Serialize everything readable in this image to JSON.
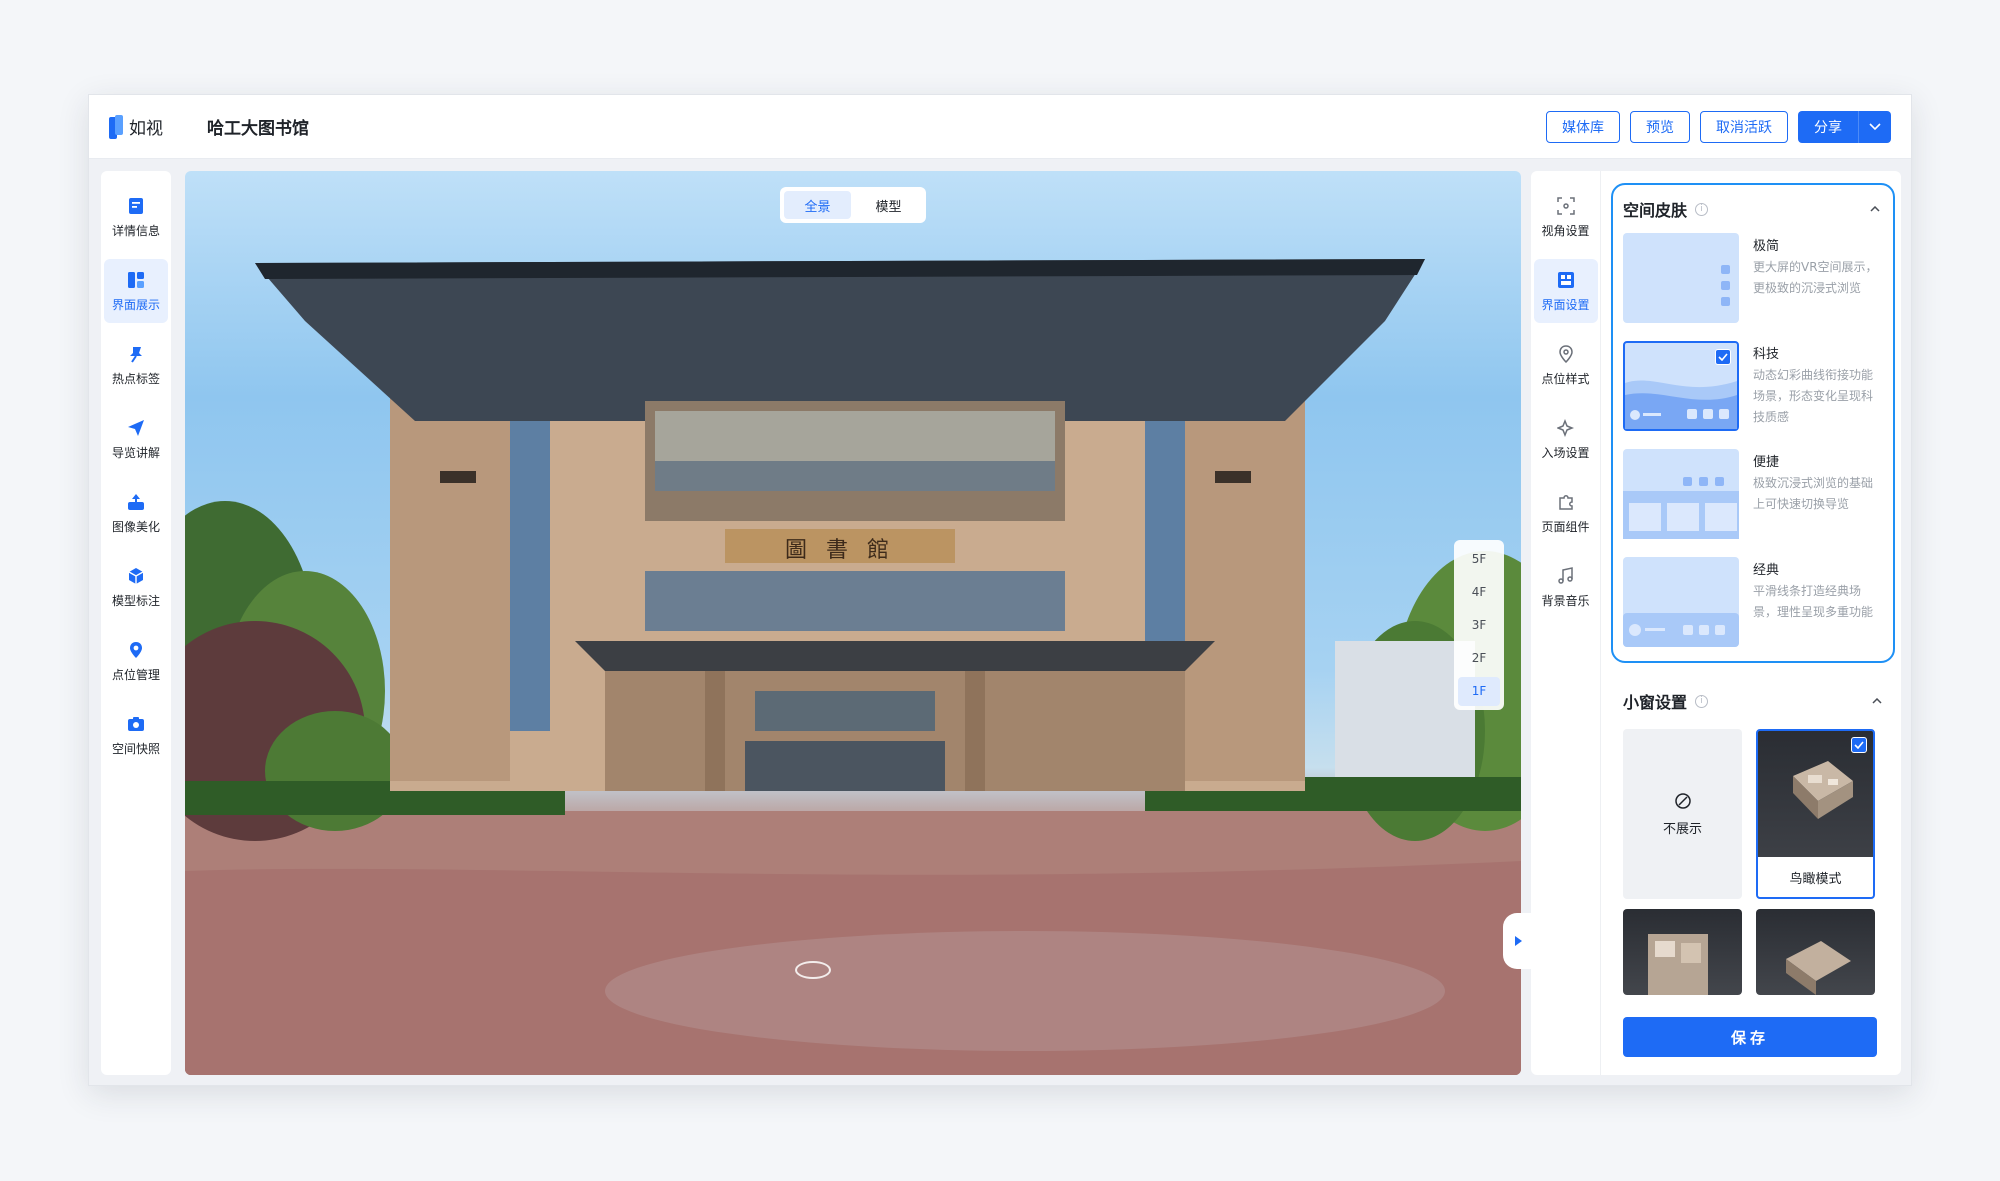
{
  "header": {
    "logo_text": "如视",
    "project_title": "哈工大图书馆",
    "actions": {
      "media_library": "媒体库",
      "preview": "预览",
      "cancel_activate": "取消活跃",
      "share": "分享"
    }
  },
  "left_nav": [
    {
      "label": "详情信息",
      "icon": "document-icon"
    },
    {
      "label": "界面展示",
      "icon": "layout-icon",
      "active": true
    },
    {
      "label": "热点标签",
      "icon": "pin-icon"
    },
    {
      "label": "导览讲解",
      "icon": "send-icon"
    },
    {
      "label": "图像美化",
      "icon": "upload-image-icon"
    },
    {
      "label": "模型标注",
      "icon": "cube-icon"
    },
    {
      "label": "点位管理",
      "icon": "location-icon"
    },
    {
      "label": "空间快照",
      "icon": "camera-icon"
    }
  ],
  "viewer": {
    "view_toggle": [
      "全景",
      "模型"
    ],
    "active_view": "全景",
    "building_sign": "圖 書 館",
    "floors": [
      "5F",
      "4F",
      "3F",
      "2F",
      "1F"
    ],
    "active_floor": "1F"
  },
  "right_nav": [
    {
      "label": "视角设置",
      "icon": "viewfinder-icon"
    },
    {
      "label": "界面设置",
      "icon": "interface-icon",
      "active": true
    },
    {
      "label": "点位样式",
      "icon": "location-outline-icon"
    },
    {
      "label": "入场设置",
      "icon": "sparkle-icon"
    },
    {
      "label": "页面组件",
      "icon": "puzzle-icon"
    },
    {
      "label": "背景音乐",
      "icon": "music-icon"
    }
  ],
  "panel": {
    "skin_section": {
      "title": "空间皮肤",
      "options": [
        {
          "name": "极简",
          "desc": "更大屏的VR空间展示，更极致的沉浸式浏览"
        },
        {
          "name": "科技",
          "desc": "动态幻彩曲线衔接功能场景，形态变化呈现科技质感",
          "selected": true
        },
        {
          "name": "便捷",
          "desc": "极致沉浸式浏览的基础上可快速切换导览"
        },
        {
          "name": "经典",
          "desc": "平滑线条打造经典场景，理性呈现多重功能"
        }
      ]
    },
    "mini_section": {
      "title": "小窗设置",
      "options": [
        {
          "label": "不展示"
        },
        {
          "label": "鸟瞰模式",
          "selected": true
        }
      ]
    },
    "save_label": "保存"
  },
  "colors": {
    "primary": "#1e6bf5",
    "skin_border": "#1e90f5",
    "thumb_bg": "#cfe2fc"
  }
}
